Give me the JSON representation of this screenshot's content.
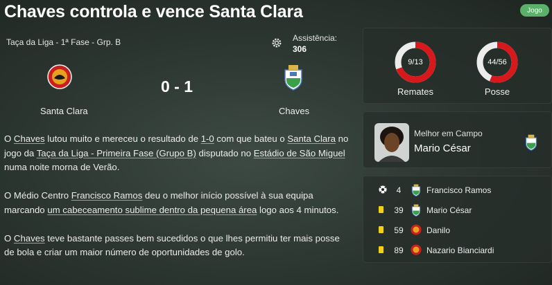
{
  "header": {
    "title": "Chaves controla e vence Santa Clara",
    "badge": "Jogo"
  },
  "match": {
    "competition": "Taça da Liga - 1ª Fase - Grp. B",
    "attendance_label": "Assistência:",
    "attendance_value": "306",
    "home_team": "Santa Clara",
    "away_team": "Chaves",
    "score": "0 - 1"
  },
  "report": {
    "p1": [
      "O ",
      "Chaves",
      " lutou muito e mereceu o resultado de ",
      "1-0",
      " com que bateu o ",
      "Santa Clara",
      " no jogo da ",
      "Taça da Liga - Primeira Fase (Grupo B)",
      " disputado no ",
      "Estádio de São Miguel",
      " numa noite morna de Verão."
    ],
    "p2": [
      "O Médio Centro ",
      "Francisco Ramos",
      " deu o melhor início possível à sua equipa marcando ",
      "um cabeceamento sublime dentro da pequena área",
      " logo aos 4 minutos."
    ],
    "p3": [
      "O ",
      "Chaves",
      " teve bastante passes bem sucedidos o que lhes permitiu ter mais posse de bola e criar um maior número de oportunidades de golo."
    ]
  },
  "stats": {
    "shots": {
      "label": "Remates",
      "text": "9/13",
      "fraction": 0.692
    },
    "possession": {
      "label": "Posse",
      "text": "44/56",
      "fraction": 0.56
    }
  },
  "motm": {
    "title": "Melhor em Campo",
    "name": "Mario César"
  },
  "events": [
    {
      "type": "goal",
      "minute": "4",
      "team": "away",
      "player": "Francisco Ramos"
    },
    {
      "type": "yellow",
      "minute": "39",
      "team": "away",
      "player": "Mario César"
    },
    {
      "type": "yellow",
      "minute": "59",
      "team": "home",
      "player": "Danilo"
    },
    {
      "type": "yellow",
      "minute": "89",
      "team": "home",
      "player": "Nazario Bianciardi"
    }
  ],
  "colors": {
    "accent_red": "#d7191c",
    "ring_track": "#ececec",
    "badge_green": "#5bb06a",
    "card_yellow": "#f3d018"
  }
}
